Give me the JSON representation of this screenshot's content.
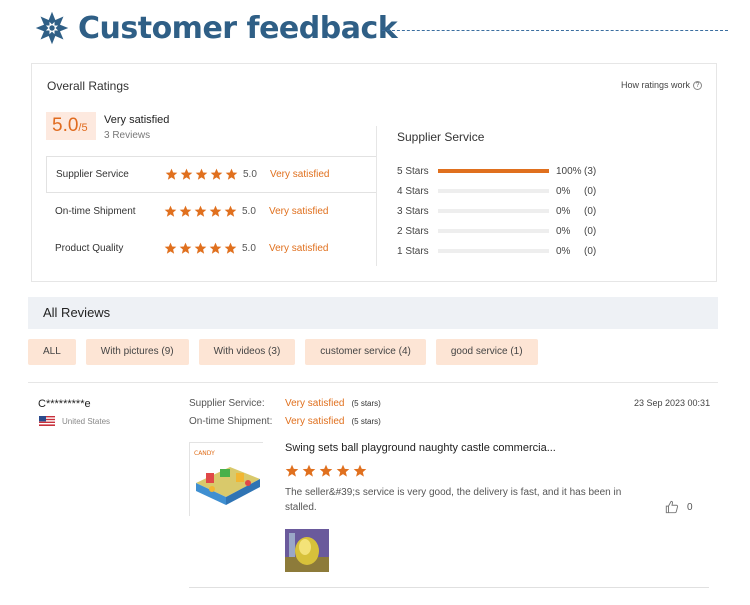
{
  "header": {
    "title": "Customer feedback",
    "icon": "snowflake-icon"
  },
  "overall": {
    "title": "Overall Ratings",
    "how_label": "How ratings work",
    "score": "5.0",
    "score_max": "/5",
    "satisfaction": "Very satisfied",
    "reviews_count": "3 Reviews",
    "categories": [
      {
        "label": "Supplier Service",
        "rating": 5,
        "value": "5.0",
        "text": "Very satisfied"
      },
      {
        "label": "On-time Shipment",
        "rating": 5,
        "value": "5.0",
        "text": "Very satisfied"
      },
      {
        "label": "Product Quality",
        "rating": 5,
        "value": "5.0",
        "text": "Very satisfied"
      }
    ]
  },
  "breakdown": {
    "title": "Supplier Service",
    "rows": [
      {
        "label": "5 Stars",
        "percent": 100,
        "pct_text": "100%",
        "count": "(3)"
      },
      {
        "label": "4 Stars",
        "percent": 0,
        "pct_text": "0%",
        "count": "(0)"
      },
      {
        "label": "3 Stars",
        "percent": 0,
        "pct_text": "0%",
        "count": "(0)"
      },
      {
        "label": "2 Stars",
        "percent": 0,
        "pct_text": "0%",
        "count": "(0)"
      },
      {
        "label": "1 Stars",
        "percent": 0,
        "pct_text": "0%",
        "count": "(0)"
      }
    ]
  },
  "all_reviews": {
    "title": "All Reviews",
    "filters": [
      "ALL",
      "With pictures (9)",
      "With videos (3)",
      "customer service (4)",
      "good service (1)"
    ]
  },
  "review": {
    "user": "C*********e",
    "country": "United States",
    "date": "23 Sep 2023 00:31",
    "supplier_label": "Supplier Service:",
    "supplier_value": "Very satisfied",
    "supplier_stars": "(5 stars)",
    "shipment_label": "On-time Shipment:",
    "shipment_value": "Very satisfied",
    "shipment_stars": "(5 stars)",
    "product_title": "Swing sets ball playground naughty castle commercia...",
    "rating": 5,
    "text": "The seller&#39;s service is very good, the delivery is fast, and it has been installed.",
    "likes": "0"
  },
  "colors": {
    "accent": "#e0701e",
    "brand": "#2f5f86",
    "chip_bg": "#fde5d5",
    "score_bg": "#fde9df"
  }
}
